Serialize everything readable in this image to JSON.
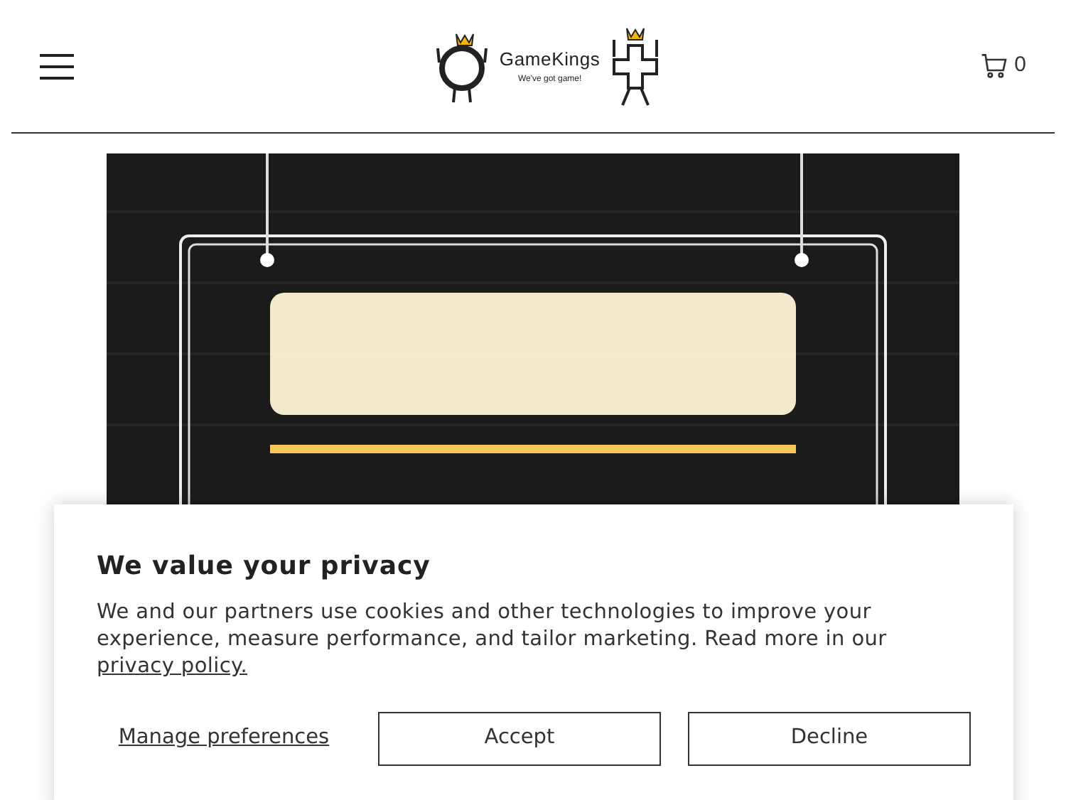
{
  "header": {
    "logo": {
      "name": "GameKings",
      "tagline": "We've got game!"
    },
    "cart_count": "0"
  },
  "cookie_banner": {
    "title": "We value your privacy",
    "text": "We and our partners use cookies and other technologies to improve your experience, measure performance, and tailor marketing. Read more in our",
    "link": "privacy policy.",
    "manage": "Manage preferences",
    "buttons": [
      "Accept",
      "Decline"
    ]
  }
}
